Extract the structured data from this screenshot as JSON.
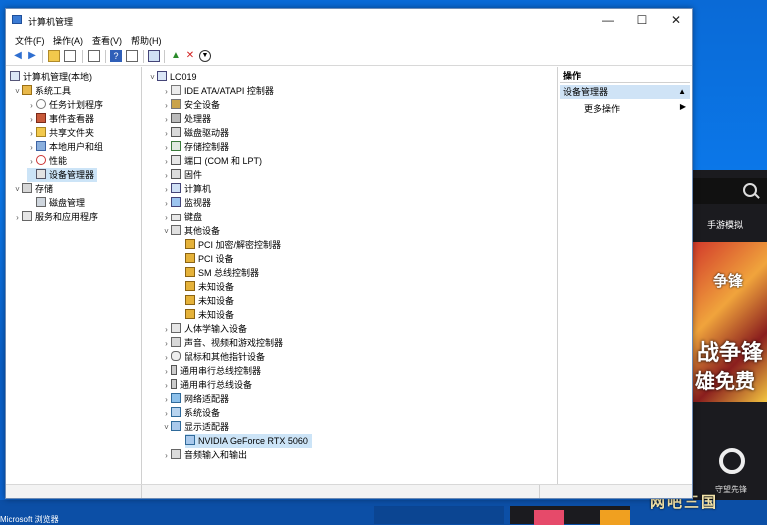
{
  "window": {
    "title": "计算机管理",
    "controls": {
      "minimize": "—",
      "maximize": "☐",
      "close": "✕"
    }
  },
  "menu": [
    "文件(F)",
    "操作(A)",
    "查看(V)",
    "帮助(H)"
  ],
  "left_tree": {
    "root": "计算机管理(本地)",
    "items": [
      {
        "label": "系统工具",
        "level": 1,
        "expanded": true
      },
      {
        "label": "任务计划程序",
        "level": 2
      },
      {
        "label": "事件查看器",
        "level": 2
      },
      {
        "label": "共享文件夹",
        "level": 2
      },
      {
        "label": "本地用户和组",
        "level": 2
      },
      {
        "label": "性能",
        "level": 2
      },
      {
        "label": "设备管理器",
        "level": 2,
        "selected": true
      },
      {
        "label": "存储",
        "level": 1,
        "expanded": true
      },
      {
        "label": "磁盘管理",
        "level": 2
      },
      {
        "label": "服务和应用程序",
        "level": 1
      }
    ]
  },
  "device_tree": {
    "root": "LC019",
    "items": [
      {
        "label": "IDE ATA/ATAPI 控制器",
        "level": 1
      },
      {
        "label": "安全设备",
        "level": 1
      },
      {
        "label": "处理器",
        "level": 1
      },
      {
        "label": "磁盘驱动器",
        "level": 1
      },
      {
        "label": "存储控制器",
        "level": 1
      },
      {
        "label": "端口 (COM 和 LPT)",
        "level": 1
      },
      {
        "label": "固件",
        "level": 1
      },
      {
        "label": "计算机",
        "level": 1
      },
      {
        "label": "监视器",
        "level": 1
      },
      {
        "label": "键盘",
        "level": 1
      },
      {
        "label": "其他设备",
        "level": 1,
        "expanded": true
      },
      {
        "label": "PCI 加密/解密控制器",
        "level": 2,
        "warn": true
      },
      {
        "label": "PCI 设备",
        "level": 2,
        "warn": true
      },
      {
        "label": "SM 总线控制器",
        "level": 2,
        "warn": true
      },
      {
        "label": "未知设备",
        "level": 2,
        "warn": true
      },
      {
        "label": "未知设备",
        "level": 2,
        "warn": true
      },
      {
        "label": "未知设备",
        "level": 2,
        "warn": true
      },
      {
        "label": "人体学输入设备",
        "level": 1
      },
      {
        "label": "声音、视频和游戏控制器",
        "level": 1
      },
      {
        "label": "鼠标和其他指针设备",
        "level": 1
      },
      {
        "label": "通用串行总线控制器",
        "level": 1
      },
      {
        "label": "通用串行总线设备",
        "level": 1
      },
      {
        "label": "网络适配器",
        "level": 1
      },
      {
        "label": "系统设备",
        "level": 1
      },
      {
        "label": "显示适配器",
        "level": 1,
        "expanded": true
      },
      {
        "label": "NVIDIA GeForce RTX 5060",
        "level": 2,
        "selected": true
      },
      {
        "label": "音频输入和输出",
        "level": 1
      }
    ]
  },
  "actions": {
    "header": "操作",
    "section": "设备管理器",
    "more": "更多操作"
  },
  "background_app": {
    "tab": "手游模拟",
    "banner_top": "争锋",
    "banner_mid": "战争锋",
    "banner_bottom": "雄免费",
    "icon_label": "守望先锋"
  },
  "watermark": "网吧三国",
  "desktop_label": "Microsoft 浏览器"
}
